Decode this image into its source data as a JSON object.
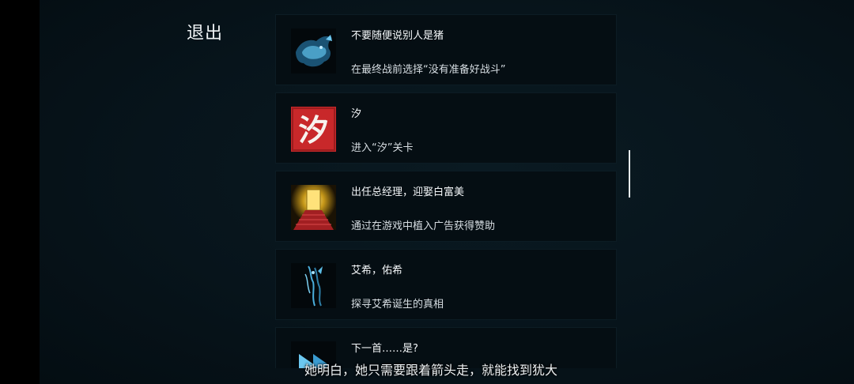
{
  "exit_label": "退出",
  "achievements": [
    {
      "title": "不要随便说别人是猪",
      "desc": "在最终战前选择“没有准备好战斗”",
      "icon": "blue-pig-icon"
    },
    {
      "title": "汐",
      "desc": "进入“汐”关卡",
      "icon": "red-xi-character-icon",
      "glyph": "汐"
    },
    {
      "title": "出任总经理，迎娶白富美",
      "desc": "通过在游戏中植入广告获得赞助",
      "icon": "golden-door-red-stairs-icon"
    },
    {
      "title": "艾希，佑希",
      "desc": "探寻艾希诞生的真相",
      "icon": "blue-figure-icon"
    },
    {
      "title": "下一首……是?",
      "desc": "",
      "icon": "fast-forward-icon"
    }
  ],
  "subtitle": "她明白，她只需要跟着箭头走，就能找到犹大",
  "colors": {
    "background": "#07141b",
    "card": "#050e13",
    "accent_red": "#c8282a",
    "accent_blue": "#3aa6d8",
    "accent_gold": "#e8c24a"
  }
}
